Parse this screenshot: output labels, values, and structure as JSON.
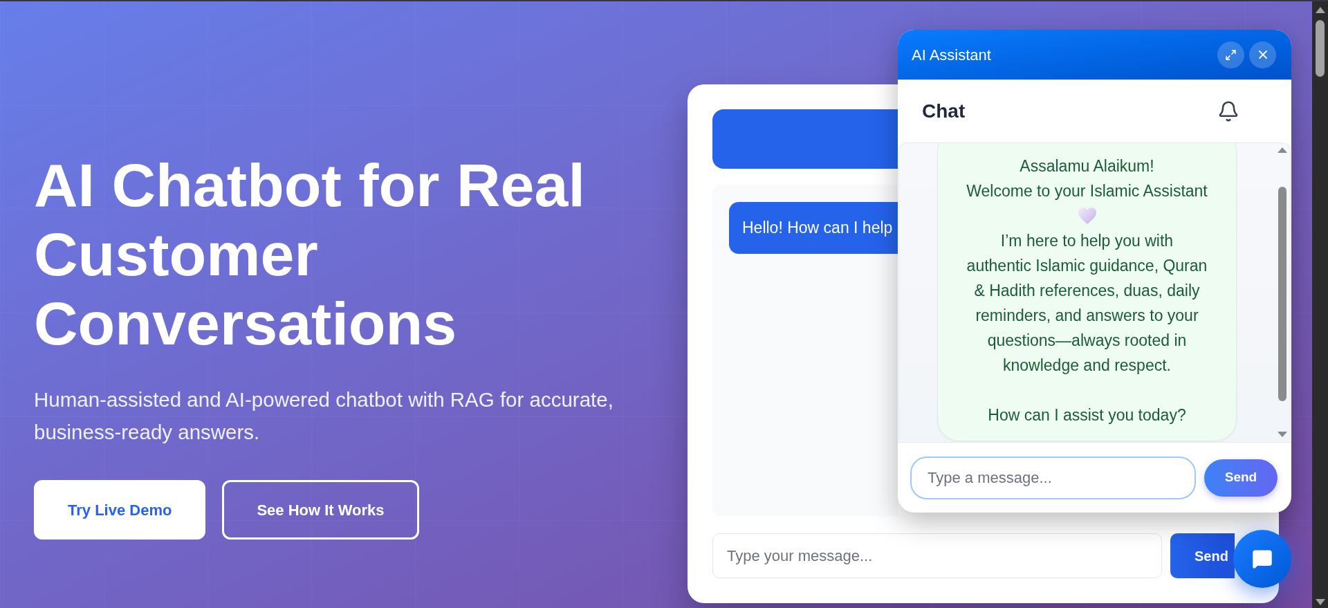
{
  "hero": {
    "title": "AI Chatbot for Real Customer Conversations",
    "subtitle": "Human-assisted and AI-powered chatbot with RAG for accurate, business-ready answers.",
    "buttons": [
      {
        "label": "Try Live Demo",
        "kind": "primary"
      },
      {
        "label": "See How It Works",
        "kind": "outline"
      }
    ]
  },
  "demo_card": {
    "messages": [
      "Hello! How can I help"
    ],
    "input": {
      "placeholder": "Type your message..."
    },
    "send_button": "Send"
  },
  "chat_widget": {
    "title": "AI Assistant",
    "section_title": "Chat",
    "messages": [
      {
        "greeting": "Assalamu Alaikum!",
        "welcome": "Welcome to your Islamic Assistant",
        "body": "I’m here to help you with authentic Islamic guidance, Quran & Hadith references, duas, daily reminders, and answers to your questions—always rooted in knowledge and respect.",
        "closing": "How can I assist you today?"
      }
    ],
    "input": {
      "placeholder": "Type a message..."
    },
    "send_button": "Send"
  }
}
